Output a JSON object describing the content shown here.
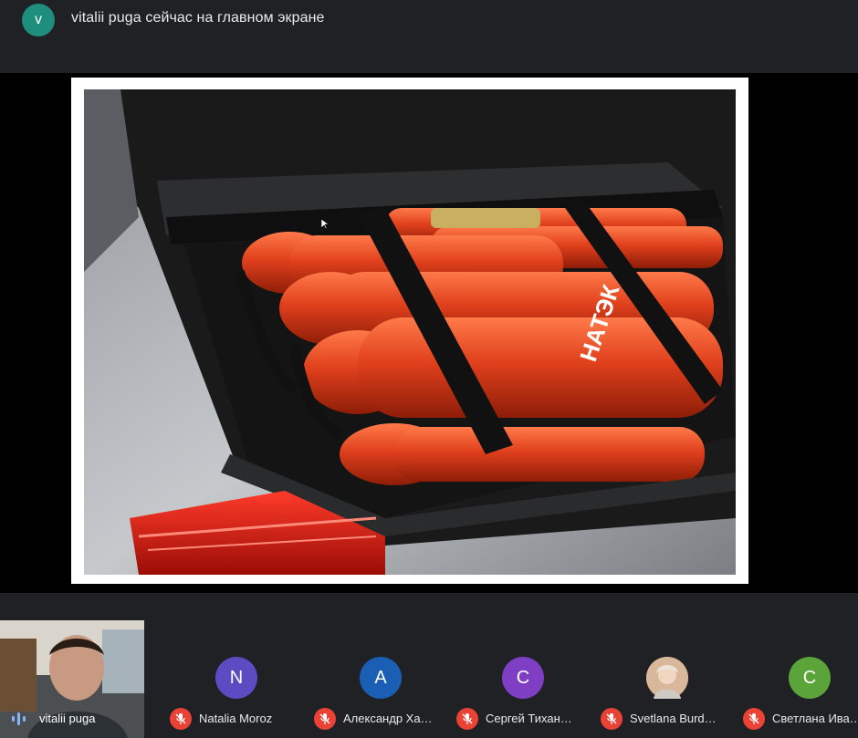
{
  "header": {
    "presenter_initial": "v",
    "presenting_text": "vitalii puga сейчас на главном экране"
  },
  "slide": {
    "image_label": "НАТЭК",
    "cursor_icon": "pointer-arrow-icon"
  },
  "self_view": {
    "name": "vitalii puga",
    "status_icon": "speaking-indicator-icon"
  },
  "participants": [
    {
      "initial": "N",
      "name": "Natalia Moroz",
      "avatar_color": "#5b4cc4",
      "muted": true
    },
    {
      "initial": "A",
      "name": "Александр Ха…",
      "avatar_color": "#1a5fb4",
      "muted": true
    },
    {
      "initial": "С",
      "name": "Сергей Тихан…",
      "avatar_color": "#7e3fc4",
      "muted": true
    },
    {
      "initial": "",
      "name": "Svetlana Burd…",
      "avatar_color": "#c9a27a",
      "muted": true,
      "photo": true
    },
    {
      "initial": "С",
      "name": "Светлана Ива…",
      "avatar_color": "#5aa43a",
      "muted": true
    }
  ],
  "colors": {
    "background": "#202124",
    "mic_off": "#ea4335",
    "cylinder": "#e0401c"
  }
}
